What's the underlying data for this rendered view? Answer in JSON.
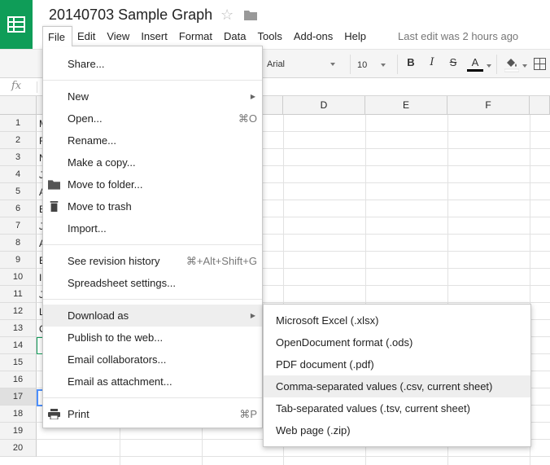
{
  "app": {
    "doc_title": "20140703 Sample Graph",
    "last_edit": "Last edit was 2 hours ago",
    "brand_color": "#0f9d58"
  },
  "menubar": [
    {
      "label": "File",
      "active": true
    },
    {
      "label": "Edit"
    },
    {
      "label": "View"
    },
    {
      "label": "Insert"
    },
    {
      "label": "Format"
    },
    {
      "label": "Data"
    },
    {
      "label": "Tools"
    },
    {
      "label": "Add-ons"
    },
    {
      "label": "Help"
    }
  ],
  "toolbar": {
    "font": "Arial",
    "font_size": "10",
    "bold": "B",
    "italic": "I",
    "strike": "S",
    "text_color": "A"
  },
  "formula_bar": {
    "icon": "fx"
  },
  "grid": {
    "columns": [
      "D",
      "E",
      "F"
    ],
    "rows": [
      "1",
      "2",
      "3",
      "4",
      "5",
      "6",
      "7",
      "8",
      "9",
      "10",
      "11",
      "12",
      "13",
      "14",
      "15",
      "16",
      "17",
      "18",
      "19",
      "20"
    ],
    "col_a_visible": [
      "M",
      "F",
      "N",
      "J",
      "A",
      "E",
      "J",
      "A",
      "E",
      "I",
      "J",
      "L",
      "O",
      "",
      "",
      "",
      "",
      "",
      "",
      ""
    ],
    "selected_row": "17"
  },
  "file_menu": {
    "items": [
      {
        "label": "Share..."
      },
      {
        "label": "New",
        "submenu": true
      },
      {
        "label": "Open...",
        "shortcut": "⌘O"
      },
      {
        "label": "Rename..."
      },
      {
        "label": "Make a copy..."
      },
      {
        "label": "Move to folder...",
        "icon": "folder-icon"
      },
      {
        "label": "Move to trash",
        "icon": "trash-icon"
      },
      {
        "label": "Import..."
      },
      {
        "label": "See revision history",
        "shortcut": "⌘+Alt+Shift+G"
      },
      {
        "label": "Spreadsheet settings..."
      },
      {
        "label": "Download as",
        "submenu": true,
        "highlighted": true
      },
      {
        "label": "Publish to the web..."
      },
      {
        "label": "Email collaborators..."
      },
      {
        "label": "Email as attachment..."
      },
      {
        "label": "Print",
        "shortcut": "⌘P",
        "icon": "print-icon"
      }
    ]
  },
  "download_submenu": {
    "items": [
      {
        "label": "Microsoft Excel (.xlsx)"
      },
      {
        "label": "OpenDocument format (.ods)"
      },
      {
        "label": "PDF document (.pdf)"
      },
      {
        "label": "Comma-separated values (.csv, current sheet)",
        "highlighted": true
      },
      {
        "label": "Tab-separated values (.tsv, current sheet)"
      },
      {
        "label": "Web page (.zip)"
      }
    ]
  }
}
